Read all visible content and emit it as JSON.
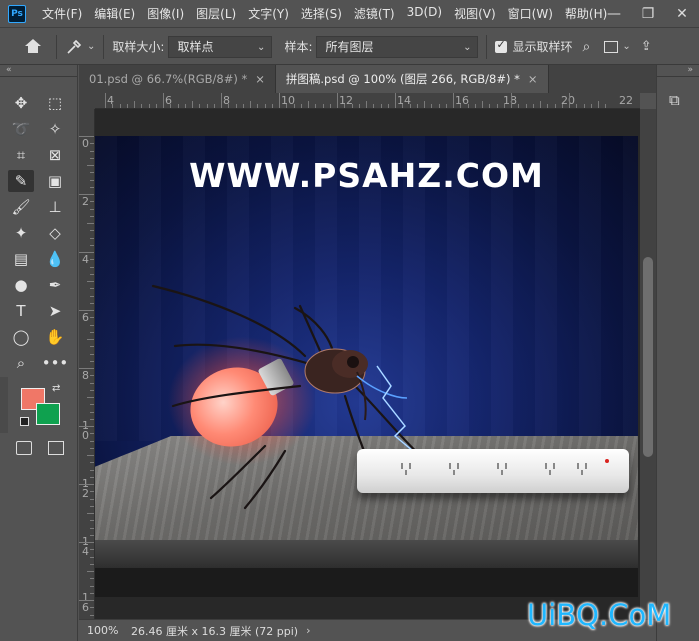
{
  "menu": {
    "logo": "Ps",
    "items": [
      "文件(F)",
      "编辑(E)",
      "图像(I)",
      "图层(L)",
      "文字(Y)",
      "选择(S)",
      "滤镜(T)",
      "3D(D)",
      "视图(V)",
      "窗口(W)",
      "帮助(H)"
    ],
    "minimize": "—",
    "restore": "❐",
    "close": "✕"
  },
  "options": {
    "sample_size_label": "取样大小:",
    "sample_size_value": "取样点",
    "sample_label": "样本:",
    "sample_value": "所有图层",
    "show_ring_label": "显示取样环",
    "show_ring_checked": true
  },
  "tabs": [
    {
      "label": "01.psd @ 66.7%(RGB/8#) *",
      "active": false
    },
    {
      "label": "拼图稿.psd @ 100% (图层 266, RGB/8#) *",
      "active": true
    }
  ],
  "ruler": {
    "top": [
      "4",
      "6",
      "8",
      "10",
      "12",
      "14",
      "16",
      "18",
      "20",
      "22"
    ],
    "left": [
      "0",
      "2",
      "4",
      "6",
      "8",
      "10",
      "12",
      "14",
      "16"
    ]
  },
  "canvas": {
    "title": "WWW.PSAHZ.COM",
    "colors": {
      "foreground": "#f07767",
      "background": "#0fa14f"
    }
  },
  "status": {
    "zoom": "100%",
    "doc_size": "26.46 厘米 x 16.3 厘米 (72 ppi)",
    "caret": "›"
  },
  "watermark": "UiBQ.CoM"
}
